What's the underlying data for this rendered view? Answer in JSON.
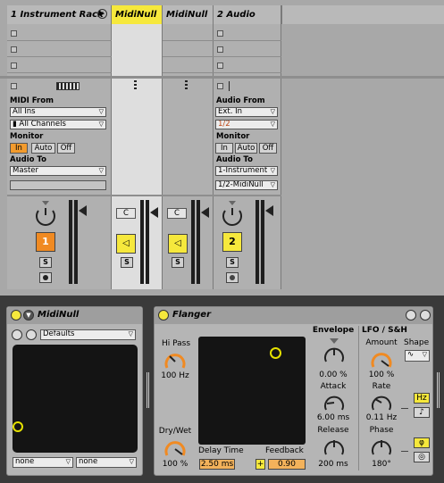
{
  "session": {
    "tracks": [
      {
        "name": "1 Instrument Rack",
        "number": "1",
        "solo": "S"
      },
      {
        "name": "MidiNull",
        "crossfade": "C",
        "solo": "S"
      },
      {
        "name": "MidiNull",
        "crossfade": "C",
        "solo": "S"
      },
      {
        "name": "2 Audio",
        "number": "2",
        "solo": "S"
      }
    ],
    "track1_io": {
      "input_label": "MIDI From",
      "input_value": "All Ins",
      "channel_value": "All Channels",
      "monitor_label": "Monitor",
      "monitor_in": "In",
      "monitor_auto": "Auto",
      "monitor_off": "Off",
      "output_label": "Audio To",
      "output_value": "Master"
    },
    "track2_io": {
      "input_label": "Audio From",
      "input_value": "Ext. In",
      "channel_value": "1/2",
      "monitor_label": "Monitor",
      "monitor_in": "In",
      "monitor_auto": "Auto",
      "monitor_off": "Off",
      "output_label": "Audio To",
      "output_value": "1-Instrument",
      "output_sub": "1/2-MidiNull"
    }
  },
  "midinull": {
    "title": "MidiNull",
    "preset": "Defaults",
    "x_source": "none",
    "y_source": "none"
  },
  "flanger": {
    "title": "Flanger",
    "hipass_label": "Hi Pass",
    "hipass_value": "100 Hz",
    "drywet_label": "Dry/Wet",
    "drywet_value": "100 %",
    "delay_label": "Delay Time",
    "delay_value": "2.50 ms",
    "feedback_label": "Feedback",
    "feedback_sign": "+",
    "feedback_value": "0.90",
    "envelope_label": "Envelope",
    "envelope_value": "0.00 %",
    "attack_label": "Attack",
    "attack_value": "6.00 ms",
    "release_label": "Release",
    "release_value": "200 ms",
    "lfo_label": "LFO / S&H",
    "amount_label": "Amount",
    "amount_value": "100 %",
    "shape_label": "Shape",
    "rate_label": "Rate",
    "rate_value": "0.11 Hz",
    "hz_label": "Hz",
    "phase_label": "Phase",
    "phase_value": "180°",
    "phi_label": "φ"
  },
  "colors": {
    "accent_orange": "#f39b2c",
    "track_yellow": "#f6e83c",
    "pad_dark": "#141414"
  }
}
